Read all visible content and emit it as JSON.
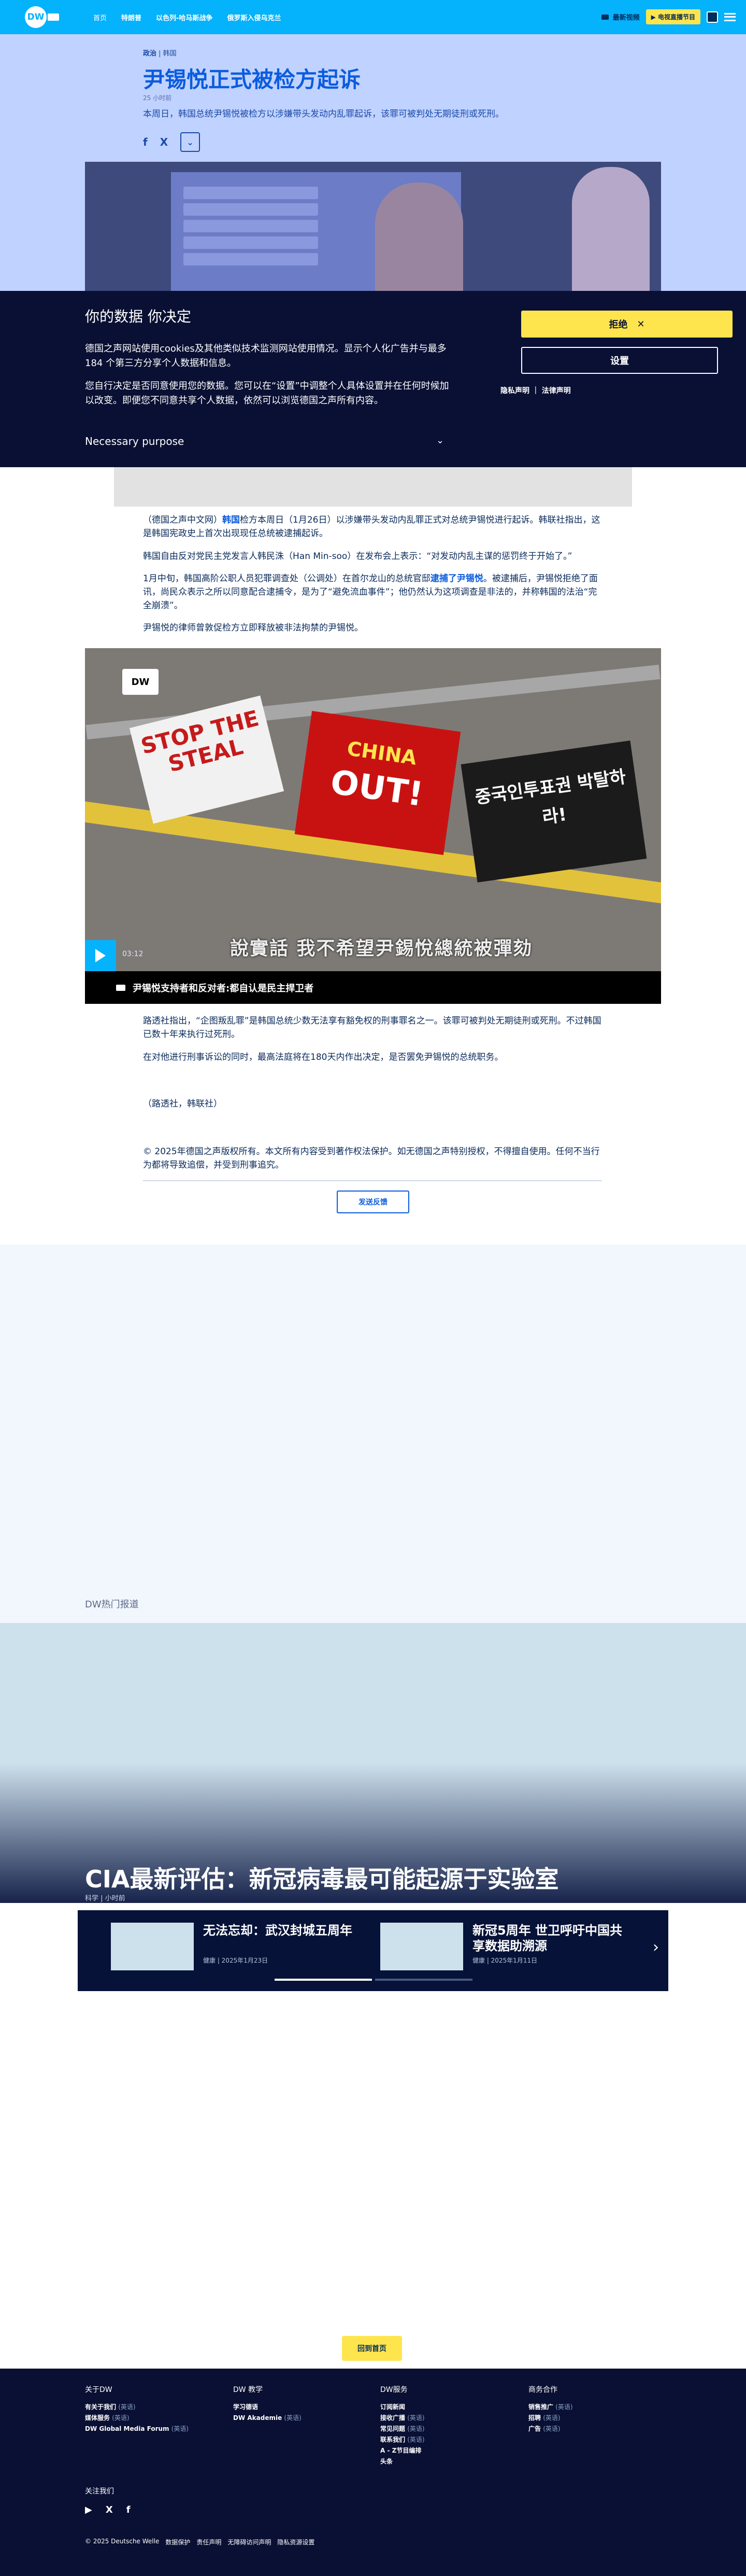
{
  "header": {
    "logo": "DW",
    "nav": [
      "首页",
      "特朗普",
      "以色列-哈马斯战争",
      "俄罗斯入侵乌克兰"
    ],
    "live_label": "最新视频",
    "live_tv_label": "▶ 电视直播节目",
    "colors": {
      "bar": "#05b2fc",
      "accent": "#fee54e"
    }
  },
  "article": {
    "breadcrumb": {
      "section": "政治",
      "subsection": "韩国"
    },
    "title": "尹锡悦正式被检方起诉",
    "date": "25 小时前",
    "lead": "本周日，韩国总统尹锡悦被检方以涉嫌带头发动内乱罪起诉，该罪可被判处无期徒刑或死刑。",
    "share_icons": [
      "f",
      "X",
      "⌄"
    ],
    "paragraphs": [
      {
        "pre": "（德国之声中文网）",
        "bold": "韩国",
        "post": "检方本周日（1月26日）以涉嫌带头发动内乱罪正式对总统尹锡悦进行起诉。韩联社指出，这是韩国宪政史上首次出现现任总统被逮捕起诉。"
      },
      {
        "pre": "",
        "bold": "",
        "post": "韩国自由反对党民主党发言人韩民洙（Han Min-soo）在发布会上表示：“对发动内乱主谋的惩罚终于开始了。”"
      },
      {
        "pre": "1月中旬，韩国高阶公职人员犯罪调查处（公调处）在首尔龙山的总统官邸",
        "bold": "逮捕了尹锡悦",
        "post": "。被逮捕后，尹锡悦拒绝了面讯，尚民众表示之所以同意配合逮捕令，是为了“避免流血事件”；他仍然认为这项调查是非法的，并称韩国的法治“完全崩溃”。"
      },
      {
        "pre": "",
        "bold": "",
        "post": "尹锡悦的律师曾敦促检方立即释放被非法拘禁的尹锡悦。"
      }
    ],
    "paragraphs_after": [
      "路透社指出，“企图叛乱罪”是韩国总统少数无法享有豁免权的刑事罪名之一。该罪可被判处无期徒刑或死刑。不过韩国已数十年来执行过死刑。",
      "在对他进行刑事诉讼的同时，最高法庭将在180天内作出决定，是否罢免尹锡悦的总统职务。",
      "（路透社，韩联社）"
    ],
    "copyright": "© 2025年德国之声版权所有。本文所有内容受到著作权法保护。如无德国之声特别授权，不得擅自使用。任何不当行为都将导致追偿，并受到刑事追究。",
    "feedback_label": "发送反馈",
    "video": {
      "badge": "DW",
      "sign1": "STOP THE STEAL",
      "sign2_top": "CHINA",
      "sign2_main": "OUT!",
      "sign3": "중국인투표권 박탈하라!",
      "subtitle": "說實話 我不希望尹錫悅總統被彈劾",
      "time": "03:12",
      "caption": "尹锡悦支持者和反对者:都自认是民主捍卫者"
    }
  },
  "cookie": {
    "title": "你的数据 你决定",
    "p1": "德国之声网站使用cookies及其他类似技术监测网站使用情况。显示个人化广告并与最多184 个第三方分享个人数据和信息。",
    "p2": "您自行决定是否同意使用您的数据。您可以在“设置”中调整个人具体设置并在任何时候加以改变。即便您不同意共享个人数据，依然可以浏览德国之声所有内容。",
    "purpose": "Necessary purpose",
    "reject_label": "拒绝",
    "settings_label": "设置",
    "links": "隐私声明 ｜ 法律声明"
  },
  "related": {
    "section_title": "DW热门报道",
    "feature_title": "CIA最新评估：新冠病毒最可能起源于实验室",
    "feature_meta": "科学 | 小时前",
    "cards": [
      {
        "title": "无法忘却：武汉封城五周年",
        "meta": "健康 | 2025年1月23日"
      },
      {
        "title": "新冠5周年 世卫呼吁中国共享数据助溯源",
        "meta": "健康 | 2025年1月11日"
      }
    ]
  },
  "back_to_top": "回到首页",
  "footer": {
    "columns": [
      {
        "title": "关于DW",
        "links": [
          {
            "t": "有关于我们",
            "s": "(英语)"
          },
          {
            "t": "媒体服务",
            "s": "(英语)"
          },
          {
            "t": "DW Global Media Forum",
            "s": "(英语)"
          }
        ]
      },
      {
        "title": "DW 教学",
        "links": [
          {
            "t": "学习德语",
            "s": ""
          },
          {
            "t": "DW Akademie",
            "s": "(英语)"
          }
        ]
      },
      {
        "title": "DW服务",
        "links": [
          {
            "t": "订阅新闻",
            "s": ""
          },
          {
            "t": "接收广播",
            "s": "(英语)"
          },
          {
            "t": "常见问题",
            "s": "(英语)"
          },
          {
            "t": "联系我们",
            "s": "(英语)"
          },
          {
            "t": "A - Z节目编排",
            "s": ""
          },
          {
            "t": "头条",
            "s": ""
          }
        ]
      },
      {
        "title": "商务合作",
        "links": [
          {
            "t": "销售推广",
            "s": "(英语)"
          },
          {
            "t": "招聘",
            "s": "(英语)"
          },
          {
            "t": "广告",
            "s": "(英语)"
          }
        ]
      }
    ],
    "follow": "关注我们",
    "socials": [
      "▶",
      "X",
      "f"
    ],
    "bottom_links": [
      "© 2025 Deutsche Welle",
      "数据保护",
      "责任声明",
      "无障碍访问声明",
      "隐私资源设置"
    ]
  }
}
